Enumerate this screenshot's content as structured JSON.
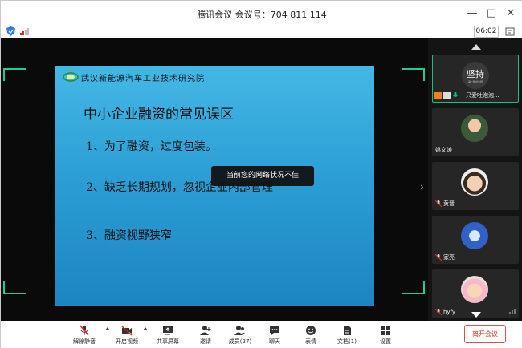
{
  "window": {
    "title": "腾讯会议  会议号：704 811 114",
    "controls": [
      "minimize-icon",
      "maximize-icon",
      "close-icon"
    ]
  },
  "status": {
    "elapsed_time": "06:02"
  },
  "slide": {
    "org_name": "武汉新能源汽车工业技术研究院",
    "title": "中小企业融资的常见误区",
    "items": [
      "1、为了融资，过度包装。",
      "2、缺乏长期规划，忽视企业内部管理",
      "3、融资视野狭窄"
    ]
  },
  "toast": {
    "text": "当前您的网络状况不佳"
  },
  "participants": [
    {
      "name": "一只爱吐泡泡...",
      "avatar_text": "坚持",
      "avatar_subtext": "第一利益法则",
      "active": true
    },
    {
      "name": "姚文涛",
      "avatar": "person-photo"
    },
    {
      "name": "黄晋",
      "avatar": "child-photo"
    },
    {
      "name": "家亮",
      "avatar": "cartoon-avatar"
    },
    {
      "name": "hyfy",
      "avatar": "pig-avatar"
    }
  ],
  "toolbar": {
    "unmute": "解除静音",
    "start_video": "开启视频",
    "share_screen": "共享屏幕",
    "invite": "邀请",
    "members": "成员(27)",
    "chat": "聊天",
    "reactions": "表情",
    "documents": "文档(1)",
    "settings": "设置",
    "leave": "离开会议"
  },
  "colors": {
    "accent_green": "#14c280",
    "leave_red": "#e02020",
    "slide_blue": "#2c9fd6"
  }
}
